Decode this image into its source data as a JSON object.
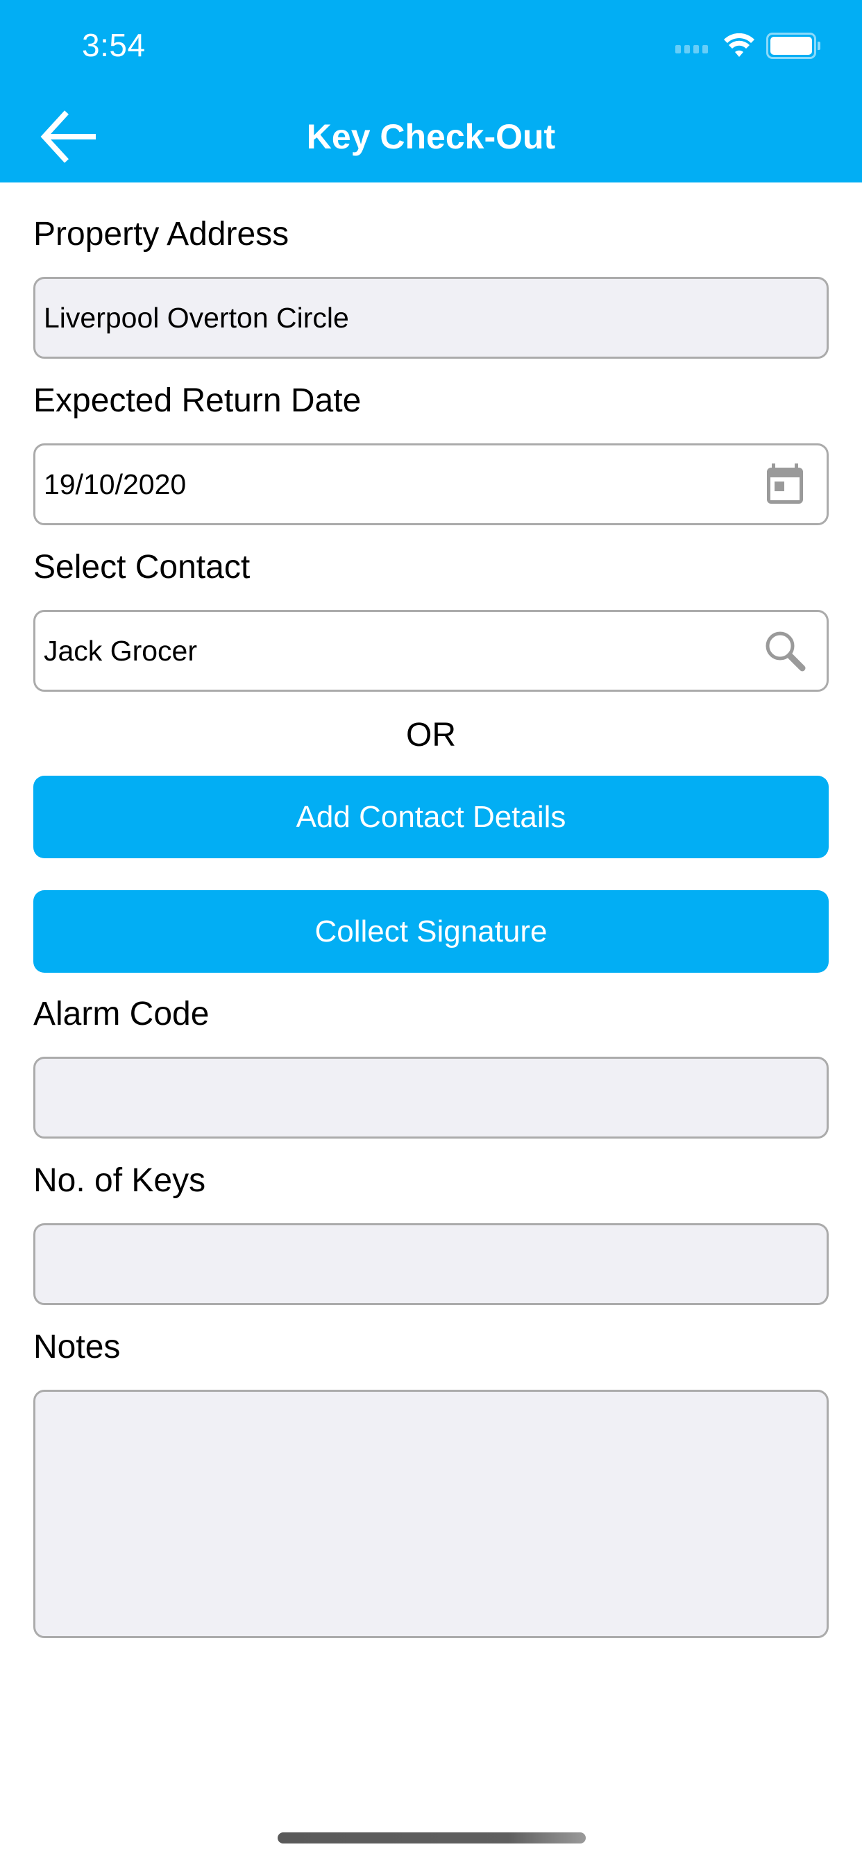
{
  "status_bar": {
    "time": "3:54",
    "icons": [
      "cellular-signal-icon",
      "wifi-icon",
      "battery-icon"
    ]
  },
  "nav": {
    "title": "Key Check-Out",
    "back_icon": "arrow-left-icon"
  },
  "colors": {
    "accent": "#02AEF4",
    "field_border": "#ababab",
    "field_fill_readonly": "#f0f0f5",
    "icon_grey": "#9a9a9a"
  },
  "form": {
    "property_address": {
      "label": "Property Address",
      "value": "Liverpool Overton Circle"
    },
    "expected_return_date": {
      "label": "Expected Return Date",
      "value": "19/10/2020",
      "icon": "calendar-icon"
    },
    "select_contact": {
      "label": "Select Contact",
      "value": "Jack Grocer",
      "icon": "search-icon"
    },
    "or_text": "OR",
    "add_contact_button": "Add Contact Details",
    "collect_signature_button": "Collect Signature",
    "alarm_code": {
      "label": "Alarm Code",
      "value": ""
    },
    "no_of_keys": {
      "label": "No. of Keys",
      "value": ""
    },
    "notes": {
      "label": "Notes",
      "value": ""
    }
  }
}
